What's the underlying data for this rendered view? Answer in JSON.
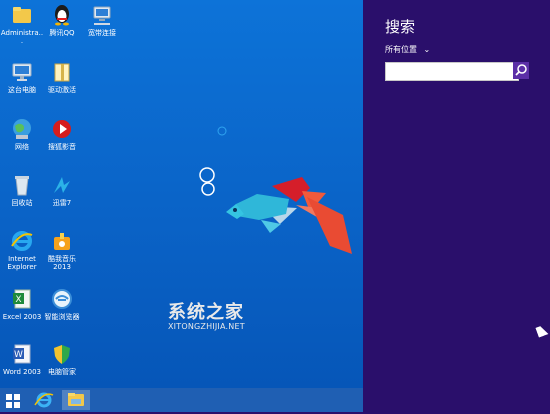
{
  "desktop": {
    "icons": [
      {
        "label": "Administra...",
        "icon": "folder-icon"
      },
      {
        "label": "腾讯QQ",
        "icon": "qq-penguin-icon"
      },
      {
        "label": "宽带连接",
        "icon": "broadband-connection-icon"
      },
      {
        "label": "这台电脑",
        "icon": "this-pc-icon"
      },
      {
        "label": "驱动激活",
        "icon": "driver-activate-icon"
      },
      {
        "label": "网络",
        "icon": "network-globe-icon"
      },
      {
        "label": "搜狐影音",
        "icon": "sohu-video-icon"
      },
      {
        "label": "回收站",
        "icon": "recycle-bin-icon"
      },
      {
        "label": "迅雷7",
        "icon": "xunlei-icon"
      },
      {
        "label": "Internet Explorer",
        "icon": "internet-explorer-icon"
      },
      {
        "label": "酷我音乐 2013",
        "icon": "kuwo-music-icon"
      },
      {
        "label": "Excel 2003",
        "icon": "excel-icon"
      },
      {
        "label": "智能浏览器",
        "icon": "smart-browser-icon"
      },
      {
        "label": "Word 2003",
        "icon": "word-icon"
      },
      {
        "label": "电脑管家",
        "icon": "pc-manager-shield-icon"
      }
    ],
    "watermark": {
      "cn": "系统之家",
      "en": "XITONGZHIJIA.NET"
    }
  },
  "taskbar": {
    "items": [
      {
        "icon": "windows-start-icon"
      },
      {
        "icon": "internet-explorer-taskbar-icon"
      },
      {
        "icon": "file-explorer-taskbar-icon"
      }
    ]
  },
  "search_charm": {
    "title": "搜索",
    "scope": "所有位置",
    "input_value": "",
    "colors": {
      "background": "#2a0f6b",
      "button": "#5b2fa7"
    }
  }
}
